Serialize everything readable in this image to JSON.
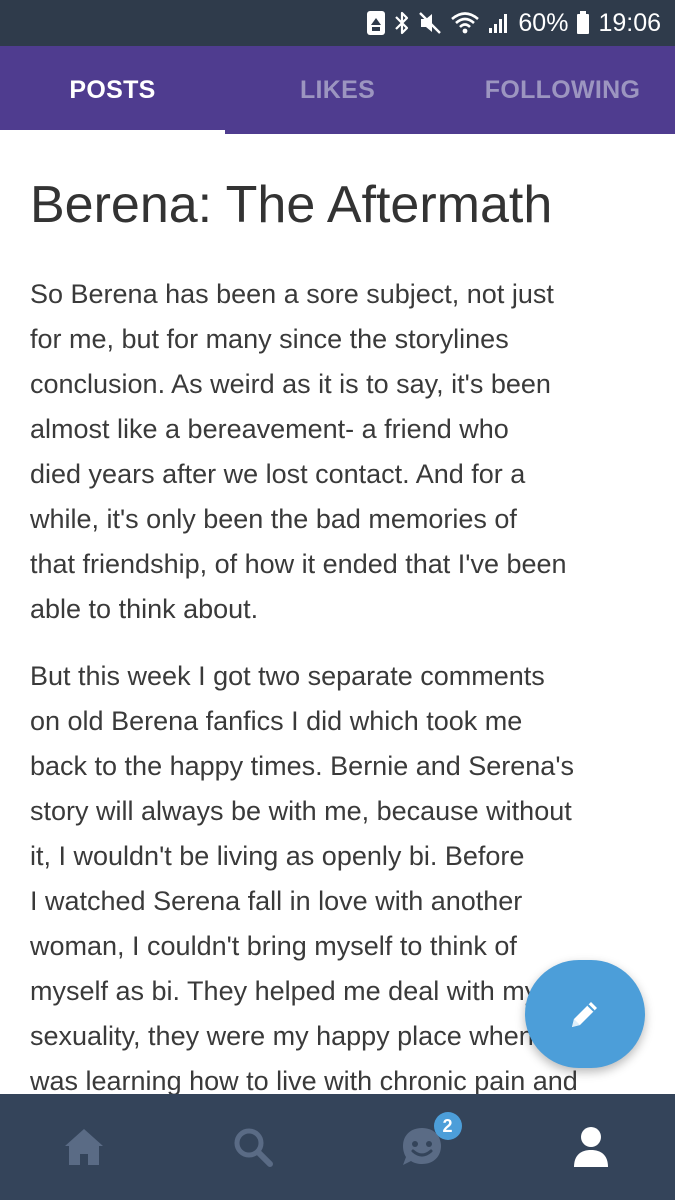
{
  "status_bar": {
    "battery_percent": "60%",
    "time": "19:06",
    "icons": [
      "storage-icon",
      "bluetooth-icon",
      "mute-icon",
      "wifi-icon",
      "signal-icon",
      "battery-icon"
    ]
  },
  "tabs": [
    {
      "label": "POSTS",
      "active": true
    },
    {
      "label": "LIKES",
      "active": false
    },
    {
      "label": "FOLLOWING",
      "active": false
    }
  ],
  "post": {
    "title": "Berena: The Aftermath",
    "paragraphs": [
      "So Berena has been a sore subject, not just\nfor me, but for many since the storylines\nconclusion. As weird as it is to say, it's been\nalmost like a bereavement- a friend who\ndied years after we lost contact. And for a\nwhile, it's only been the bad memories of\nthat friendship, of how it ended that I've been\nable to think about.",
      "But this week I got two separate comments\non old Berena fanfics I did which took me\nback to the happy times. Bernie and Serena's\nstory will always be with me, because without\nit, I wouldn't be living as openly bi. Before\nI watched Serena fall in love with another\nwoman, I couldn't bring myself to think of\nmyself as bi. They helped me deal with my\nsexuality, they were my happy place when I\nwas learning how to live with chronic pain and"
    ]
  },
  "fab": {
    "icon": "pencil-icon"
  },
  "bottom_nav": {
    "items": [
      "home-icon",
      "search-icon",
      "chat-icon",
      "profile-icon"
    ],
    "notification_count": "2"
  },
  "colors": {
    "status_bar_bg": "#2f3b4b",
    "header_bg": "#4f3c8f",
    "tab_inactive": "#9c95c0",
    "nav_bg": "#34445a",
    "nav_icon": "#5a6b85",
    "accent_blue": "#4c9ed9"
  }
}
